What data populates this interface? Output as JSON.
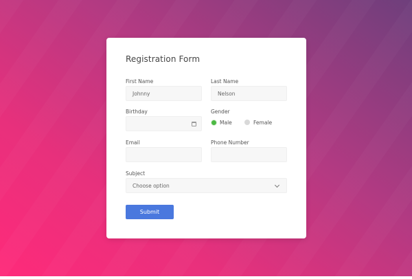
{
  "form": {
    "title": "Registration Form",
    "first_name": {
      "label": "First Name",
      "value": "Johnny"
    },
    "last_name": {
      "label": "Last Name",
      "value": "Nelson"
    },
    "birthday": {
      "label": "Birthday",
      "value": "",
      "icon": "calendar-icon"
    },
    "gender": {
      "label": "Gender",
      "options": [
        {
          "label": "Male",
          "selected": true
        },
        {
          "label": "Female",
          "selected": false
        }
      ]
    },
    "email": {
      "label": "Email",
      "value": ""
    },
    "phone": {
      "label": "Phone Number",
      "value": ""
    },
    "subject": {
      "label": "Subject",
      "selected": "Choose option",
      "icon": "chevron-down-icon"
    },
    "submit_label": "Submit"
  },
  "colors": {
    "accent": "#4a78de",
    "radio_selected": "#4cb944",
    "bg_start": "#ff2a7a",
    "bg_end": "#6e3f7c"
  }
}
